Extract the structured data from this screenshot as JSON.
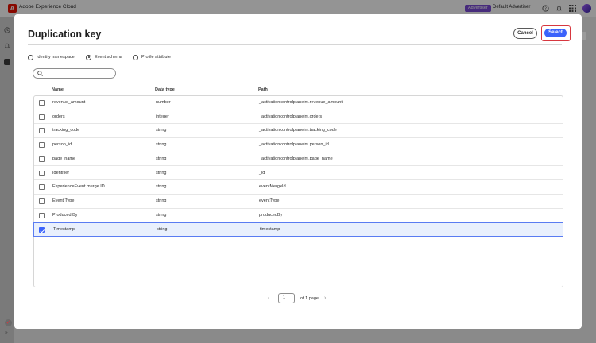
{
  "topbar": {
    "logo_letter": "A",
    "app_title": "Adobe Experience Cloud",
    "env_badge": "Advertiser",
    "org_name": "Default Advertiser",
    "icons": [
      "help-icon",
      "bell-icon",
      "apps-grid-icon",
      "user-avatar"
    ]
  },
  "modal": {
    "title": "Duplication key",
    "cancel_label": "Cancel",
    "select_label": "Select",
    "radios": [
      {
        "label": "Identity namespace",
        "selected": false
      },
      {
        "label": "Event schema",
        "selected": true
      },
      {
        "label": "Profile attribute",
        "selected": false
      }
    ],
    "search_placeholder": "",
    "columns": {
      "name": "Name",
      "type": "Data type",
      "path": "Path"
    },
    "rows": [
      {
        "name": "revenue_amount",
        "type": "number",
        "path": "_activationcontrolplaneint.revenue_amount",
        "checked": false
      },
      {
        "name": "orders",
        "type": "integer",
        "path": "_activationcontrolplaneint.orders",
        "checked": false
      },
      {
        "name": "tracking_code",
        "type": "string",
        "path": "_activationcontrolplaneint.tracking_code",
        "checked": false
      },
      {
        "name": "person_id",
        "type": "string",
        "path": "_activationcontrolplaneint.person_id",
        "checked": false
      },
      {
        "name": "page_name",
        "type": "string",
        "path": "_activationcontrolplaneint.page_name",
        "checked": false
      },
      {
        "name": "Identifier",
        "type": "string",
        "path": "_id",
        "checked": false
      },
      {
        "name": "ExperienceEvent merge ID",
        "type": "string",
        "path": "eventMergeId",
        "checked": false
      },
      {
        "name": "Event Type",
        "type": "string",
        "path": "eventType",
        "checked": false
      },
      {
        "name": "Produced By",
        "type": "string",
        "path": "producedBy",
        "checked": false
      },
      {
        "name": "Timestamp",
        "type": "string",
        "path": "timestamp",
        "checked": true
      }
    ],
    "pagination": {
      "page": "1",
      "label": "of 1 page"
    }
  },
  "colors": {
    "accent": "#3b63fb",
    "brand": "#eb1000",
    "highlight": "#d7373f",
    "selected_row": "#e9f0fd"
  }
}
